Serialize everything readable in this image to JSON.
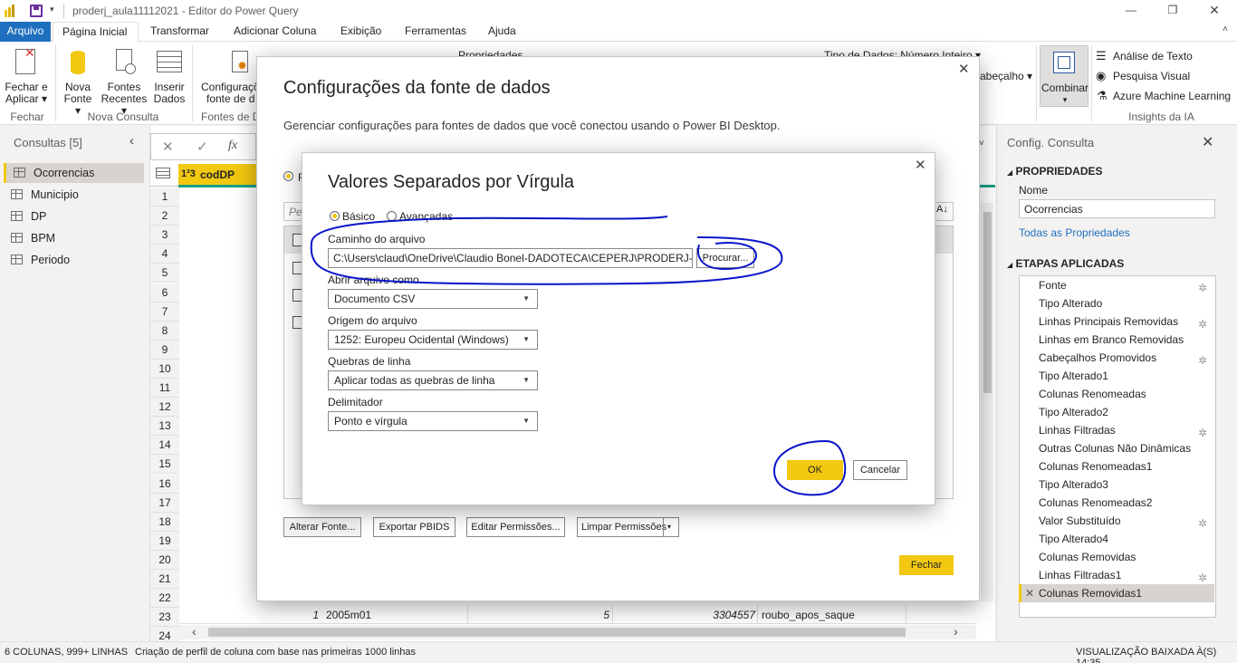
{
  "window": {
    "title": "proderj_aula11112021 - Editor do Power Query"
  },
  "tabs": [
    "Arquivo",
    "Página Inicial",
    "Transformar",
    "Adicionar Coluna",
    "Exibição",
    "Ferramentas",
    "Ajuda"
  ],
  "ribbon": {
    "close_apply": [
      "Fechar e",
      "Aplicar ▾"
    ],
    "new_source": [
      "Nova",
      "Fonte ▾"
    ],
    "recent_sources": [
      "Fontes",
      "Recentes ▾"
    ],
    "enter_data": [
      "Inserir",
      "Dados"
    ],
    "data_source_settings": [
      "Configuraçõ",
      "fonte de d"
    ],
    "properties": "Propriedades",
    "data_type": "Tipo de Dados: Número Inteiro ▾",
    "headers": "abeçalho ▾",
    "combine": "Combinar",
    "text_analytics": "Análise de Texto",
    "vision": "Pesquisa Visual",
    "azure_ml": "Azure Machine Learning",
    "groups": {
      "close": "Fechar",
      "new_query": "Nova Consulta",
      "data_sources": "Fontes de D",
      "ai_insights": "Insights da IA"
    }
  },
  "queries": {
    "header": "Consultas [5]",
    "items": [
      "Ocorrencias",
      "Municipio",
      "DP",
      "BPM",
      "Periodo"
    ]
  },
  "grid": {
    "column_header": "codDP",
    "row_numbers": [
      "1",
      "2",
      "3",
      "4",
      "5",
      "6",
      "7",
      "8",
      "9",
      "10",
      "11",
      "12",
      "13",
      "14",
      "15",
      "16",
      "17",
      "18",
      "19",
      "20",
      "21",
      "22",
      "23",
      "24"
    ],
    "visible_row": {
      "index": "1",
      "period": "2005m01",
      "value1": "5",
      "value2": "3304557",
      "value3": "roubo_apos_saque"
    }
  },
  "settings": {
    "header": "Config. Consulta",
    "properties_title": "PROPRIEDADES",
    "name_label": "Nome",
    "name_value": "Ocorrencias",
    "all_props_link": "Todas as Propriedades",
    "steps_title": "ETAPAS APLICADAS",
    "steps": [
      {
        "label": "Fonte",
        "gear": true
      },
      {
        "label": "Tipo Alterado",
        "gear": false
      },
      {
        "label": "Linhas Principais Removidas",
        "gear": true
      },
      {
        "label": "Linhas em Branco Removidas",
        "gear": false
      },
      {
        "label": "Cabeçalhos Promovidos",
        "gear": true
      },
      {
        "label": "Tipo Alterado1",
        "gear": false
      },
      {
        "label": "Colunas Renomeadas",
        "gear": false
      },
      {
        "label": "Tipo Alterado2",
        "gear": false
      },
      {
        "label": "Linhas Filtradas",
        "gear": true
      },
      {
        "label": "Outras Colunas Não Dinâmicas",
        "gear": false
      },
      {
        "label": "Colunas Renomeadas1",
        "gear": false
      },
      {
        "label": "Tipo Alterado3",
        "gear": false
      },
      {
        "label": "Colunas Renomeadas2",
        "gear": false
      },
      {
        "label": "Valor Substituído",
        "gear": true
      },
      {
        "label": "Tipo Alterado4",
        "gear": false
      },
      {
        "label": "Colunas Removidas",
        "gear": false
      },
      {
        "label": "Linhas Filtradas1",
        "gear": true
      },
      {
        "label": "Colunas Removidas1",
        "gear": false
      }
    ]
  },
  "statusbar": {
    "left": "6 COLUNAS, 999+ LINHAS",
    "middle": "Criação de perfil de coluna com base nas primeiras 1000 linhas",
    "right": "VISUALIZAÇÃO BAIXADA À(S) 14:35"
  },
  "dialog_sources": {
    "title": "Configurações da fonte de dados",
    "subtitle": "Gerenciar configurações para fontes de dados que você conectou usando o Power BI Desktop.",
    "radio_partial": "F",
    "search_partial": "Pes",
    "buttons": {
      "change_source": "Alterar Fonte...",
      "export": "Exportar PBIDS",
      "edit_perms": "Editar Permissões...",
      "clear_perms": "Limpar Permissões",
      "close": "Fechar"
    }
  },
  "dialog_csv": {
    "title": "Valores Separados por Vírgula",
    "mode_basic": "Básico",
    "mode_advanced": "Avançadas",
    "path_label": "Caminho do arquivo",
    "path_value": "C:\\Users\\claud\\OneDrive\\Claudio Bonel-DADOTECA\\CEPERJ\\PRODERJ-Pow",
    "browse": "Procurar...",
    "open_as_label": "Abrir arquivo como",
    "open_as_value": "Documento CSV",
    "origin_label": "Origem do arquivo",
    "origin_value": "1252: Europeu Ocidental (Windows)",
    "linebreaks_label": "Quebras de linha",
    "linebreaks_value": "Aplicar todas as quebras de linha",
    "delimiter_label": "Delimitador",
    "delimiter_value": "Ponto e vírgula",
    "ok": "OK",
    "cancel": "Cancelar"
  },
  "colors": {
    "accent_yellow": "#f2c811",
    "file_tab_blue": "#1e6fbf",
    "annotation_ink": "#0a14c8"
  }
}
